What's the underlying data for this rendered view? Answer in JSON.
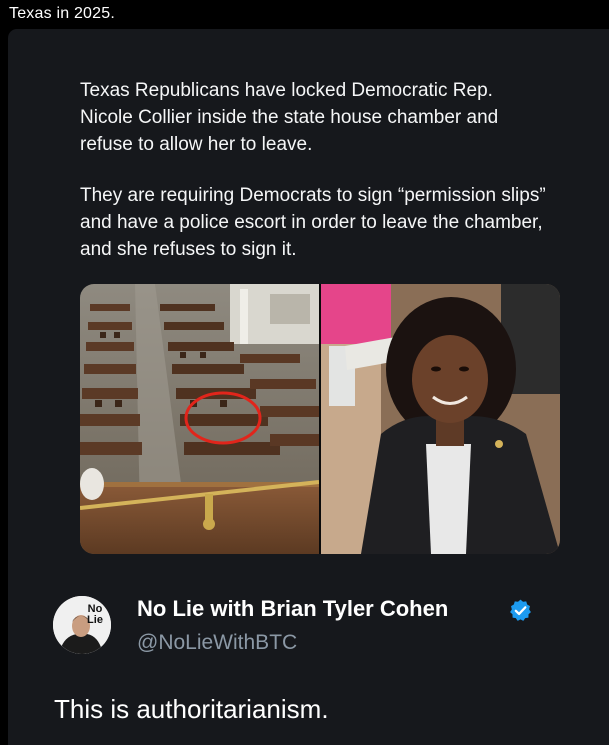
{
  "caption": "Texas in 2025.",
  "post": {
    "paragraphs": [
      "Texas Republicans have locked Democratic Rep. Nicole Collier inside the state house chamber and refuse to allow her to leave.",
      "They are requiring Democrats to sign “permission slips” and have a police escort in order to leave the chamber, and she refuses to sign it."
    ]
  },
  "media": {
    "left_image": "house-chamber-photo",
    "right_image": "portrait-photo"
  },
  "author": {
    "name": "No Lie with Brian Tyler Cohen",
    "handle": "@NoLieWithBTC",
    "avatar_text_line1": "No",
    "avatar_text_line2": "Lie",
    "verified_color": "#1d9bf0"
  },
  "quote_text": "This is authoritarianism."
}
